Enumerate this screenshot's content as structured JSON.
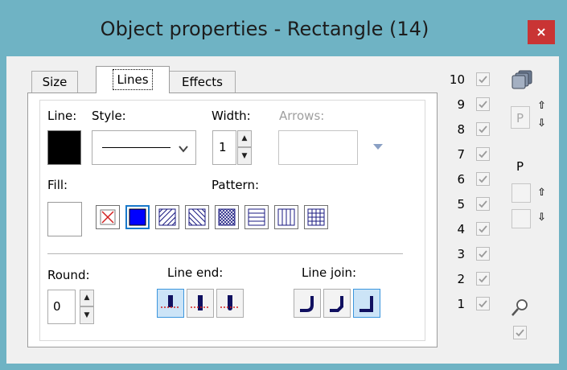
{
  "window": {
    "title": "Object properties - Rectangle (14)",
    "close_glyph": "×"
  },
  "tabs": [
    {
      "label": "Size",
      "active": false
    },
    {
      "label": "Lines",
      "active": true
    },
    {
      "label": "Effects",
      "active": false
    }
  ],
  "lines_tab": {
    "line_label": "Line:",
    "style_label": "Style:",
    "width_label": "Width:",
    "arrows_label": "Arrows:",
    "width_value": "1",
    "line_color": "#000000",
    "fill_label": "Fill:",
    "fill_color": "#ffffff",
    "pattern_label": "Pattern:",
    "patterns": [
      "none",
      "solid",
      "diagonal-up",
      "diagonal-down",
      "diagonal-cross",
      "horizontal",
      "vertical",
      "cross"
    ],
    "selected_pattern": "solid",
    "round_label": "Round:",
    "round_value": "0",
    "line_end_label": "Line end:",
    "line_ends": [
      "flat",
      "square",
      "round"
    ],
    "selected_line_end": "flat",
    "line_join_label": "Line join:",
    "line_joins": [
      "round",
      "bevel",
      "miter"
    ],
    "selected_line_join": "miter"
  },
  "layers": {
    "levels": [
      "10",
      "9",
      "8",
      "7",
      "6",
      "5",
      "4",
      "3",
      "2",
      "1"
    ],
    "all_checked": true,
    "p_button_label": "P",
    "p_label": "P"
  },
  "icons": {
    "layers_icon": "layers-icon",
    "zoom_icon": "magnifier-icon"
  },
  "colors": {
    "title_bar": "#6fb3c4",
    "close_button": "#c93434",
    "selection_blue": "#1979ca"
  }
}
